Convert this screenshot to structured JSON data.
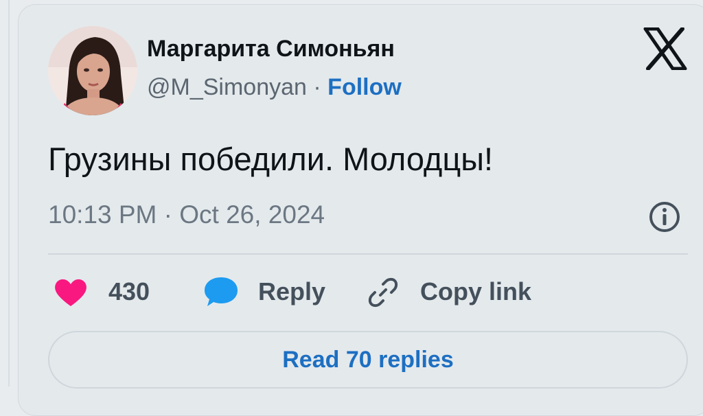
{
  "author": {
    "display_name": "Маргарита Симоньян",
    "handle": "@M_Simonyan",
    "separator": "·",
    "follow_label": "Follow"
  },
  "tweet": {
    "text": "Грузины победили. Молодцы!",
    "timestamp": "10:13 PM · Oct 26, 2024"
  },
  "actions": {
    "like_count": "430",
    "reply_label": "Reply",
    "copy_link_label": "Copy link"
  },
  "footer": {
    "read_replies_label": "Read 70 replies"
  },
  "icons": {
    "logo": "x-logo-icon",
    "info": "info-icon",
    "like": "heart-icon",
    "reply": "speech-bubble-icon",
    "copy_link": "link-icon"
  },
  "colors": {
    "like": "#f91880",
    "reply": "#1d9bf0",
    "link": "#1d6fc2",
    "text": "#0f1419",
    "muted": "#6b7782"
  }
}
